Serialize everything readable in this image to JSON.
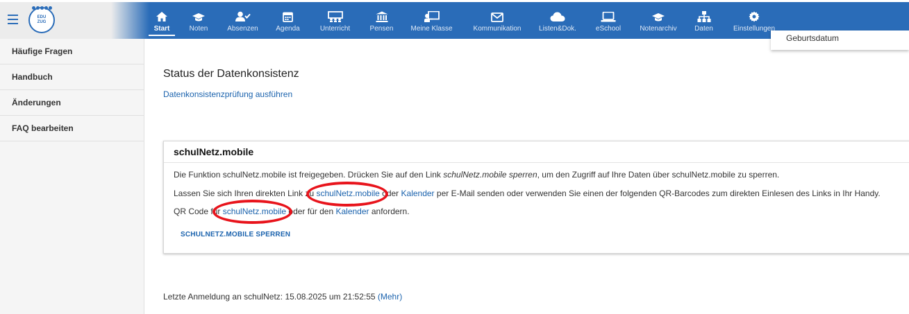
{
  "header": {
    "logo_text_1": "EDU",
    "logo_text_2": "ZUG",
    "nav": [
      {
        "label": "Start",
        "icon": "home-icon",
        "active": true
      },
      {
        "label": "Noten",
        "icon": "graduation-cap-icon"
      },
      {
        "label": "Absenzen",
        "icon": "user-check-icon"
      },
      {
        "label": "Agenda",
        "icon": "calendar-icon"
      },
      {
        "label": "Unterricht",
        "icon": "classroom-icon"
      },
      {
        "label": "Pensen",
        "icon": "institution-icon"
      },
      {
        "label": "Meine Klasse",
        "icon": "chalkboard-teacher-icon"
      },
      {
        "label": "Kommunikation",
        "icon": "envelope-icon"
      },
      {
        "label": "Listen&Dok.",
        "icon": "cloud-icon"
      },
      {
        "label": "eSchool",
        "icon": "laptop-icon"
      },
      {
        "label": "Notenarchiv",
        "icon": "graduation-cap-icon"
      },
      {
        "label": "Daten",
        "icon": "sitemap-icon"
      },
      {
        "label": "Einstellungen",
        "icon": "gear-icon"
      }
    ]
  },
  "sidebar": {
    "items": [
      "Häufige Fragen",
      "Handbuch",
      "Änderungen",
      "FAQ bearbeiten"
    ]
  },
  "dropdown": {
    "partial_item": "Geburtsdatum"
  },
  "main": {
    "title": "Status der Datenkonsistenz",
    "check_link": "Datenkonsistenzprüfung ausführen",
    "card": {
      "title": "schulNetz.mobile",
      "p1_a": "Die Funktion schulNetz.mobile ist freigegeben. Drücken Sie auf den Link ",
      "p1_em": "schulNetz.mobile sperren",
      "p1_b": ", um den Zugriff auf Ihre Daten über schulNetz.mobile zu sperren.",
      "p2_a": "Lassen Sie sich Ihren direkten Link zu ",
      "p2_link1": "schulNetz.mobile",
      "p2_b": " oder ",
      "p2_link2": "Kalender",
      "p2_c": " per E-Mail senden oder verwenden Sie einen der folgenden QR-Barcodes zum direkten Einlesen des Links in Ihr Handy.",
      "p3_a": "QR Code für ",
      "p3_link1": "schulNetz.mobile",
      "p3_b": " oder für den ",
      "p3_link2": "Kalender",
      "p3_c": " anfordern.",
      "button": "SCHULNETZ.MOBILE SPERREN"
    },
    "last_login_text": "Letzte Anmeldung an schulNetz: 15.08.2025 um 21:52:55 ",
    "last_login_more": "(Mehr)"
  },
  "colors": {
    "brand_blue": "#2a6cb8",
    "link_blue": "#1a62ad",
    "annotation_red": "#e8141c"
  }
}
